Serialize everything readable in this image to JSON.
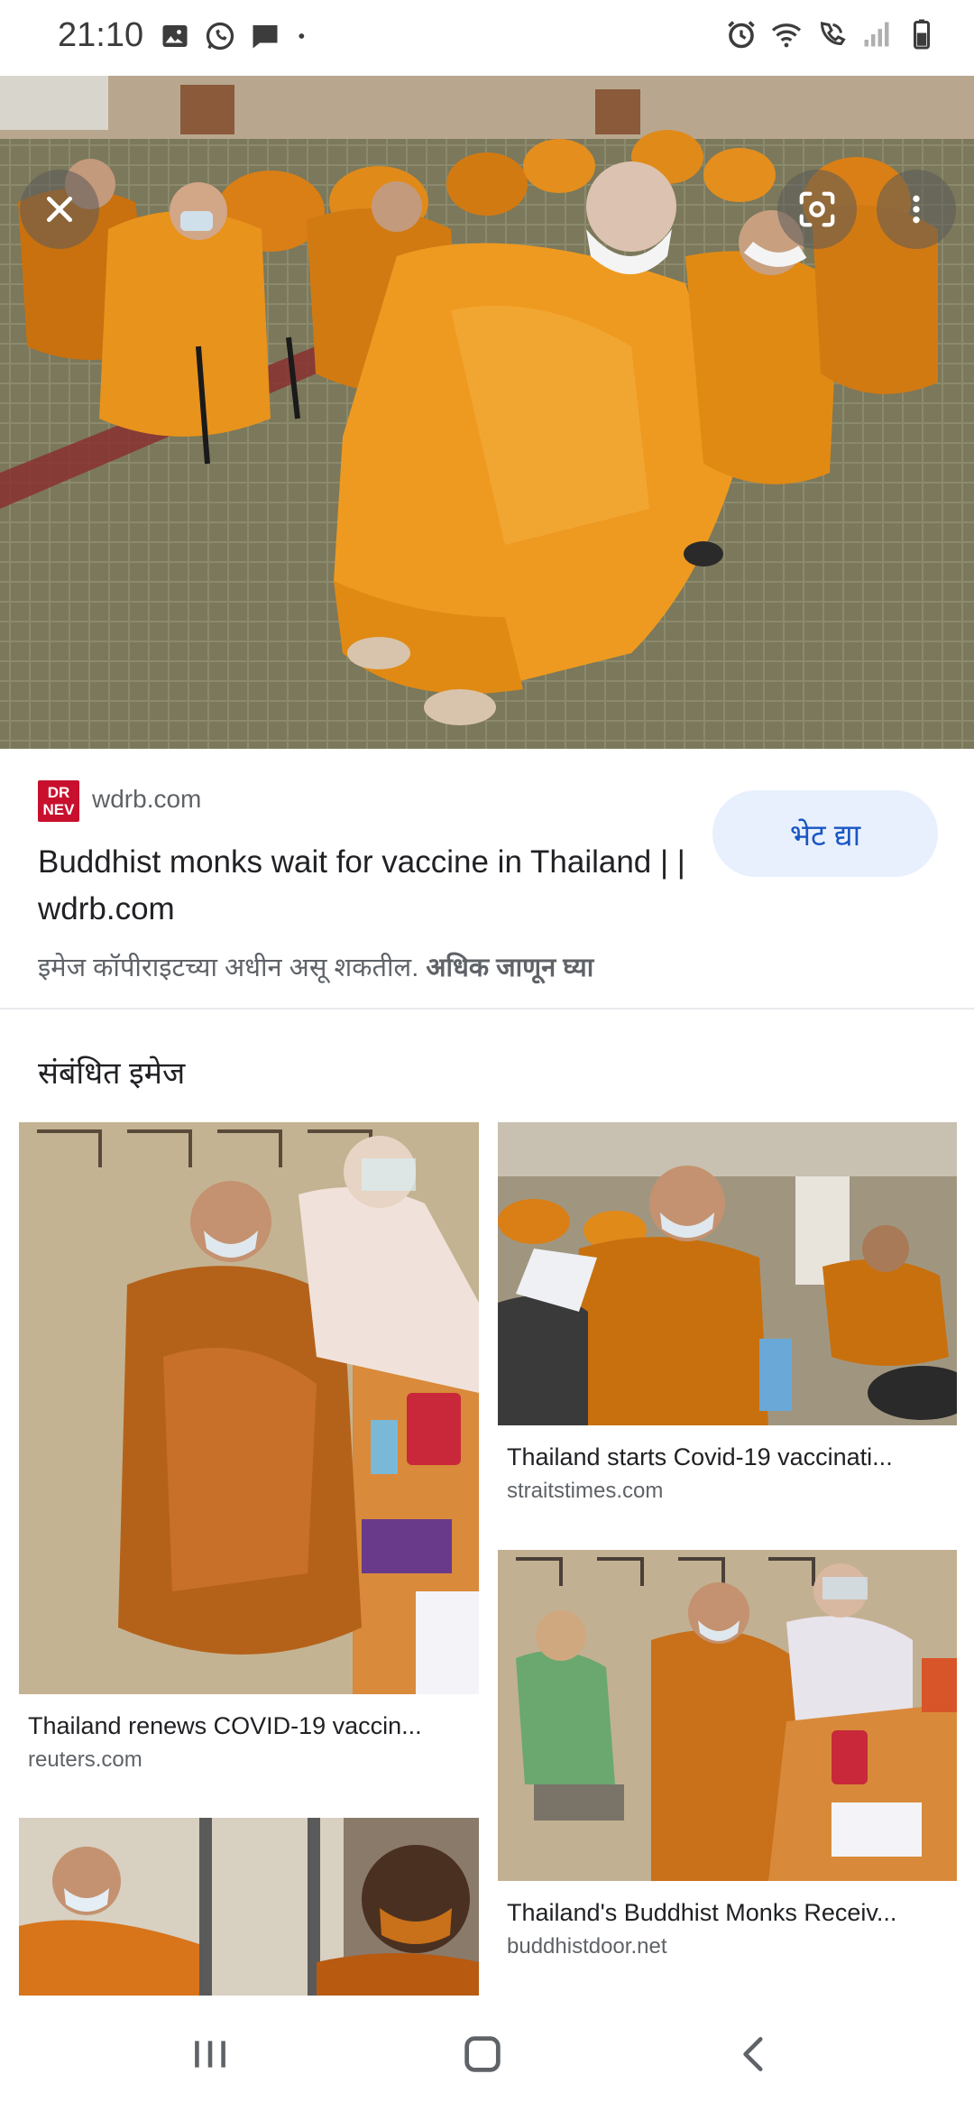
{
  "status_bar": {
    "time": "21:10",
    "left_icons": [
      "gallery-icon",
      "whatsapp-icon",
      "message-icon",
      "dot-icon"
    ],
    "right_icons": [
      "alarm-icon",
      "wifi-icon",
      "wifi-call-icon",
      "signal-icon",
      "battery-icon"
    ]
  },
  "viewer": {
    "close_icon": "close-icon",
    "lens_icon": "lens-icon",
    "more_icon": "more-vert-icon"
  },
  "source": {
    "logo_text": "WDRB NEWS",
    "logo_line1": "DR",
    "logo_line2": "NEV",
    "domain": "wdrb.com",
    "title": "Buddhist monks wait for vaccine in Thailand | | wdrb.com",
    "visit_label": "भेट द्या",
    "copyright_text": "इमेज कॉपीराइटच्या अधीन असू शकतील.",
    "learn_more": "अधिक जाणून घ्या"
  },
  "related": {
    "heading": "संबंधित इमेज",
    "items": [
      {
        "title": "Thailand renews COVID-19 vaccin...",
        "source": "reuters.com"
      },
      {
        "title": "Thailand starts Covid-19 vaccinati...",
        "source": "straitstimes.com"
      },
      {
        "title": "Thailand's Buddhist Monks Receiv...",
        "source": "buddhistdoor.net"
      },
      {
        "title": "",
        "source": ""
      }
    ]
  },
  "nav": {
    "recents_icon": "recents-icon",
    "home_icon": "home-icon",
    "back_icon": "back-icon"
  },
  "colors": {
    "accent": "#1a56c4",
    "visit_bg": "#e8f0fe",
    "robe": "#e8901c",
    "carpet": "#7d7a5e"
  }
}
